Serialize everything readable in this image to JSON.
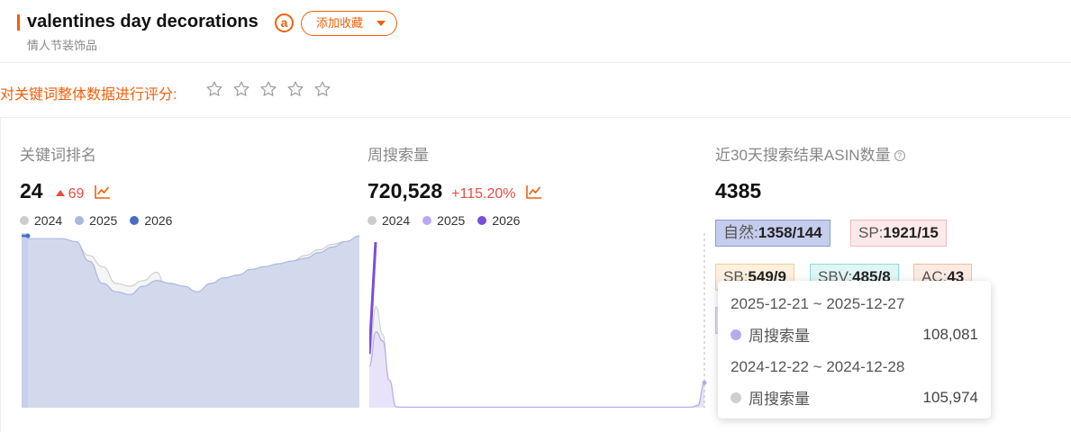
{
  "header": {
    "keyword": "valentines day decorations",
    "subtitle": "情人节装饰品",
    "amazon_icon": "amazon-a-icon",
    "favorite_label": "添加收藏"
  },
  "rating": {
    "label": "对关键词整体数据进行评分:",
    "stars_total": 5,
    "stars_selected": 0
  },
  "colors": {
    "accent": "#f0600c",
    "up": "#e84c3d",
    "y2024": "#cccccc",
    "y2025_rank": "#a9b8e0",
    "y2026_rank": "#4a6cc8",
    "y2025_search": "#bba9ef",
    "y2026_search": "#7a4fd8"
  },
  "metrics": {
    "rank": {
      "title": "关键词排名",
      "value": "24",
      "change": "69",
      "legend": [
        "2024",
        "2025",
        "2026"
      ]
    },
    "search": {
      "title": "周搜索量",
      "value": "720,528",
      "change": "+115.20%",
      "legend": [
        "2024",
        "2025",
        "2026"
      ]
    },
    "asin": {
      "title": "近30天搜索结果ASIN数量",
      "value": "4385",
      "tags": {
        "natural_label": "自然:",
        "natural_value": "1358/144",
        "sp_label": "SP:",
        "sp_value": "1921/15",
        "sb_label": "SB:",
        "sb_value": "549/9",
        "sbv_label": "SBV:",
        "sbv_value": "485/8",
        "ac_label": "AC:",
        "ac_value": "43"
      }
    }
  },
  "tooltip": {
    "range_1": "2025-12-21 ~ 2025-12-27",
    "label_1": "周搜索量",
    "value_1": "108,081",
    "range_2": "2024-12-22 ~ 2024-12-28",
    "label_2": "周搜索量",
    "value_2": "105,974"
  },
  "chart_data": [
    {
      "type": "area",
      "title": "关键词排名",
      "series": [
        {
          "name": "2024",
          "values": [
            3,
            3,
            3,
            3,
            4,
            8,
            12,
            18,
            19,
            17,
            14,
            27,
            29,
            24,
            20,
            17,
            15,
            14,
            13,
            11,
            10,
            8,
            6,
            4,
            3,
            2
          ]
        },
        {
          "name": "2025",
          "values": [
            2,
            2,
            2,
            2,
            3,
            10,
            18,
            21,
            22,
            19,
            17,
            18,
            19,
            21,
            18,
            16,
            15,
            13,
            12,
            11,
            10,
            9,
            7,
            5,
            3,
            1
          ]
        },
        {
          "name": "2026",
          "values": [
            1,
            1
          ]
        }
      ]
    },
    {
      "type": "area",
      "title": "周搜索量",
      "series": [
        {
          "name": "2024",
          "values": [
            240000,
            440000,
            320000,
            90000,
            4000,
            2500,
            2500,
            2500,
            2500,
            2500,
            2500,
            2500,
            2500,
            2500,
            2500,
            2500,
            2500,
            2500,
            2500,
            2500,
            2500,
            2500,
            2500,
            2500,
            2500,
            2500,
            2500,
            2500,
            2500,
            2500,
            2500,
            2500,
            2500,
            2500,
            2500,
            2500,
            2500,
            2500,
            2500,
            2500,
            2500,
            2500,
            2500,
            2500,
            2500,
            2500,
            2500,
            2500,
            2500,
            12000,
            105974
          ]
        },
        {
          "name": "2025",
          "values": [
            180000,
            330000,
            290000,
            120000,
            3500,
            2000,
            2000,
            2000,
            2000,
            2000,
            2000,
            2000,
            2000,
            2000,
            2000,
            2000,
            2000,
            2000,
            2000,
            2000,
            2000,
            2000,
            2000,
            2000,
            2000,
            2000,
            2000,
            2000,
            2000,
            2000,
            2000,
            2000,
            2000,
            2000,
            2000,
            2000,
            2000,
            2000,
            2000,
            2000,
            2000,
            2000,
            2000,
            2000,
            2000,
            2000,
            2000,
            2000,
            2000,
            9000,
            108081
          ]
        },
        {
          "name": "2026",
          "values": [
            234000,
            720528
          ]
        }
      ]
    }
  ]
}
